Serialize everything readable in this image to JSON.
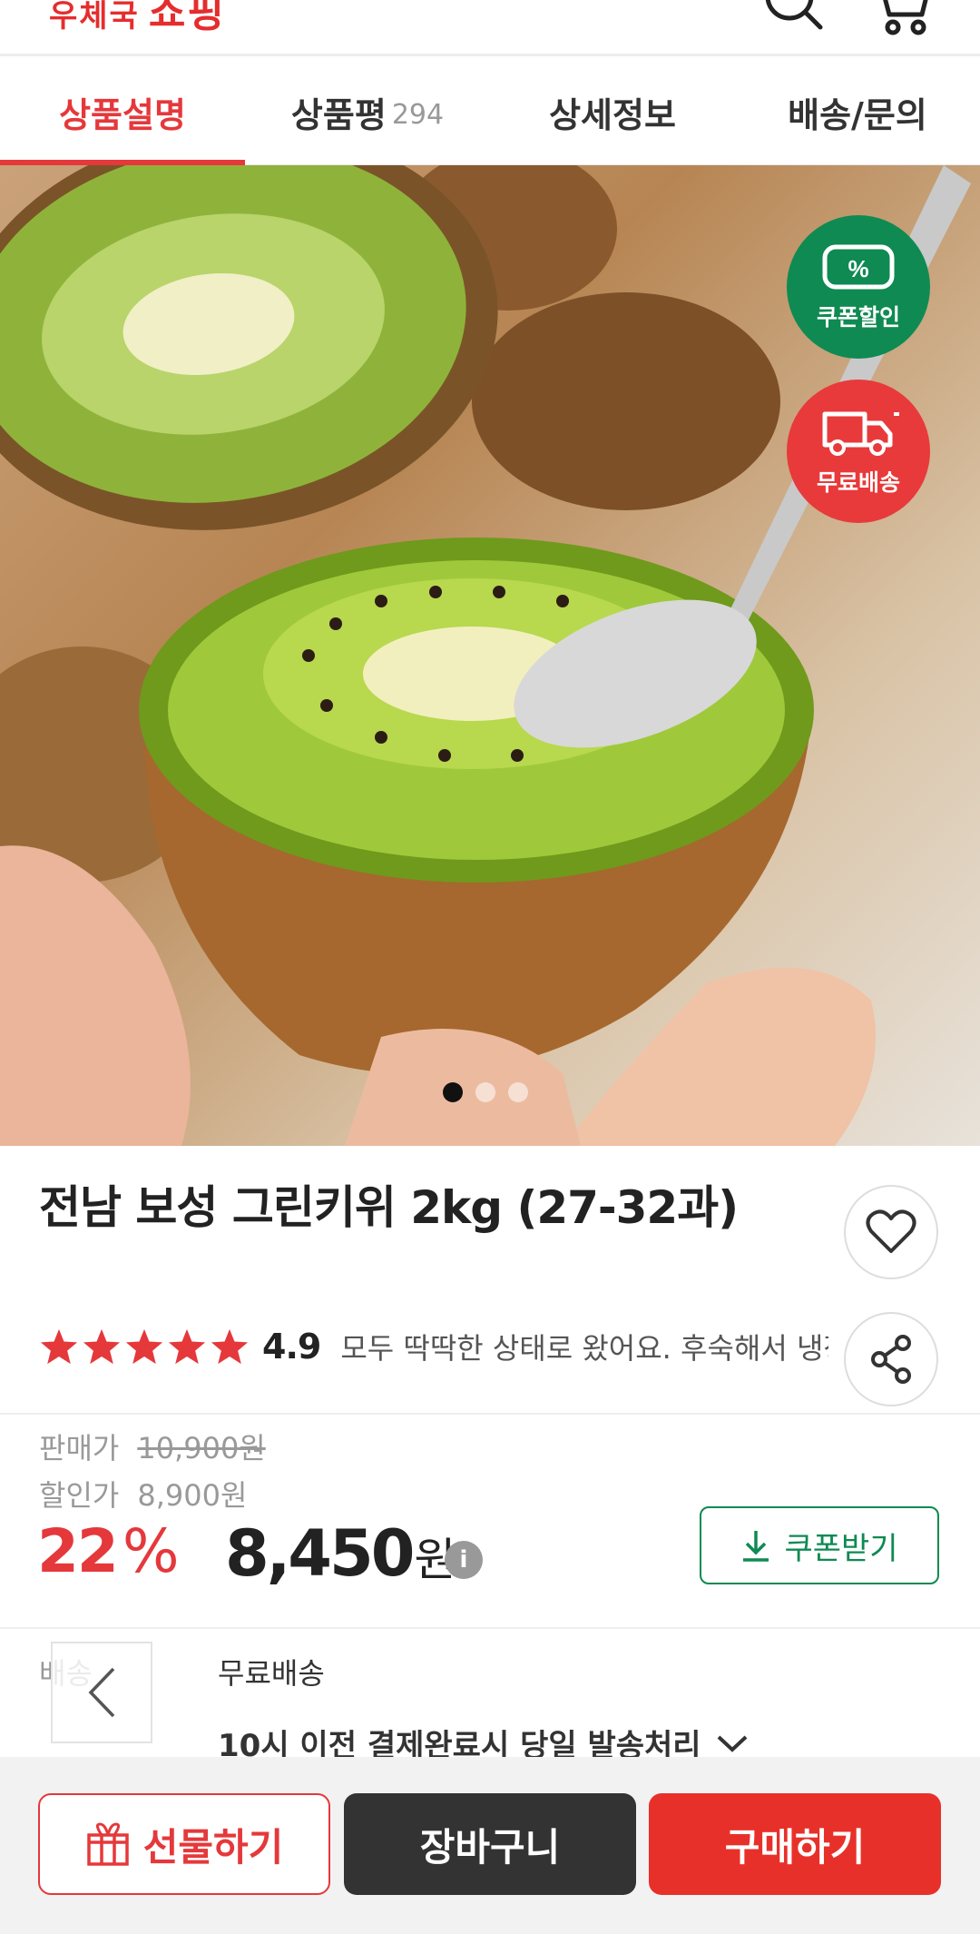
{
  "header": {
    "logo_small": "우체국",
    "logo_main": "쇼핑",
    "search_icon": "search-icon",
    "cart_icon": "cart-icon"
  },
  "tabs": [
    {
      "label": "상품설명",
      "active": true
    },
    {
      "label": "상품평",
      "count": "294"
    },
    {
      "label": "상세정보"
    },
    {
      "label": "배송/문의"
    }
  ],
  "hero": {
    "badge_coupon_symbol": "%",
    "badge_coupon": "쿠폰할인",
    "badge_shipping": "무료배송",
    "slide_count": 3,
    "current_slide": 1
  },
  "product": {
    "title": "전남 보성 그린키위 2kg (27-32과)",
    "rating": "4.9",
    "rating_stars": 5,
    "review_snippet": "모두 딱딱한 상태로 왔어요. 후숙해서 냉장보관하면 더 맛있어요"
  },
  "price": {
    "sale_label": "판매가",
    "sale_value": "10,900원",
    "discount_label": "할인가",
    "discount_value": "8,900원",
    "discount_rate": "22",
    "percent_sign": "%",
    "final_amount": "8,450",
    "final_unit": "원",
    "info_symbol": "i",
    "coupon_button": "쿠폰받기"
  },
  "shipping": {
    "label": "배송",
    "value": "무료배송",
    "note": "10시 이전 결제완료시 당일 발송처리"
  },
  "bottom_bar": {
    "gift": "선물하기",
    "cart": "장바구니",
    "buy": "구매하기"
  },
  "colors": {
    "accent_red": "#e5383b",
    "coupon_green": "#0f8a52",
    "dark_button": "#333333"
  }
}
